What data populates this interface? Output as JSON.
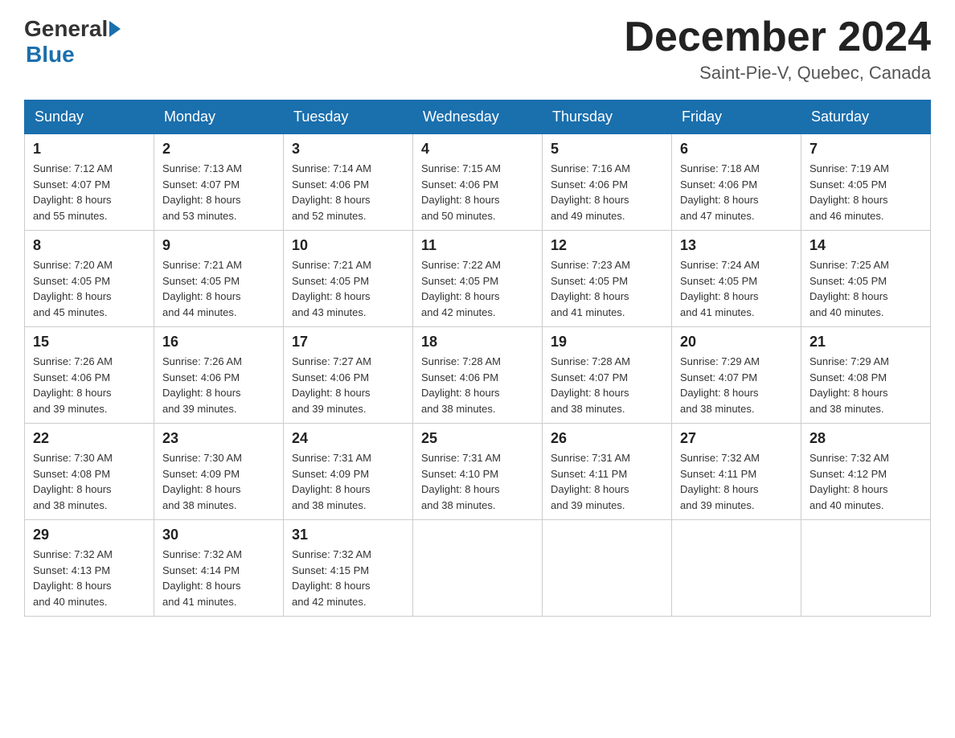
{
  "header": {
    "logo_general": "General",
    "logo_blue": "Blue",
    "title": "December 2024",
    "location": "Saint-Pie-V, Quebec, Canada"
  },
  "weekdays": [
    "Sunday",
    "Monday",
    "Tuesday",
    "Wednesday",
    "Thursday",
    "Friday",
    "Saturday"
  ],
  "weeks": [
    [
      {
        "day": "1",
        "sunrise": "7:12 AM",
        "sunset": "4:07 PM",
        "daylight": "8 hours and 55 minutes."
      },
      {
        "day": "2",
        "sunrise": "7:13 AM",
        "sunset": "4:07 PM",
        "daylight": "8 hours and 53 minutes."
      },
      {
        "day": "3",
        "sunrise": "7:14 AM",
        "sunset": "4:06 PM",
        "daylight": "8 hours and 52 minutes."
      },
      {
        "day": "4",
        "sunrise": "7:15 AM",
        "sunset": "4:06 PM",
        "daylight": "8 hours and 50 minutes."
      },
      {
        "day": "5",
        "sunrise": "7:16 AM",
        "sunset": "4:06 PM",
        "daylight": "8 hours and 49 minutes."
      },
      {
        "day": "6",
        "sunrise": "7:18 AM",
        "sunset": "4:06 PM",
        "daylight": "8 hours and 47 minutes."
      },
      {
        "day": "7",
        "sunrise": "7:19 AM",
        "sunset": "4:05 PM",
        "daylight": "8 hours and 46 minutes."
      }
    ],
    [
      {
        "day": "8",
        "sunrise": "7:20 AM",
        "sunset": "4:05 PM",
        "daylight": "8 hours and 45 minutes."
      },
      {
        "day": "9",
        "sunrise": "7:21 AM",
        "sunset": "4:05 PM",
        "daylight": "8 hours and 44 minutes."
      },
      {
        "day": "10",
        "sunrise": "7:21 AM",
        "sunset": "4:05 PM",
        "daylight": "8 hours and 43 minutes."
      },
      {
        "day": "11",
        "sunrise": "7:22 AM",
        "sunset": "4:05 PM",
        "daylight": "8 hours and 42 minutes."
      },
      {
        "day": "12",
        "sunrise": "7:23 AM",
        "sunset": "4:05 PM",
        "daylight": "8 hours and 41 minutes."
      },
      {
        "day": "13",
        "sunrise": "7:24 AM",
        "sunset": "4:05 PM",
        "daylight": "8 hours and 41 minutes."
      },
      {
        "day": "14",
        "sunrise": "7:25 AM",
        "sunset": "4:05 PM",
        "daylight": "8 hours and 40 minutes."
      }
    ],
    [
      {
        "day": "15",
        "sunrise": "7:26 AM",
        "sunset": "4:06 PM",
        "daylight": "8 hours and 39 minutes."
      },
      {
        "day": "16",
        "sunrise": "7:26 AM",
        "sunset": "4:06 PM",
        "daylight": "8 hours and 39 minutes."
      },
      {
        "day": "17",
        "sunrise": "7:27 AM",
        "sunset": "4:06 PM",
        "daylight": "8 hours and 39 minutes."
      },
      {
        "day": "18",
        "sunrise": "7:28 AM",
        "sunset": "4:06 PM",
        "daylight": "8 hours and 38 minutes."
      },
      {
        "day": "19",
        "sunrise": "7:28 AM",
        "sunset": "4:07 PM",
        "daylight": "8 hours and 38 minutes."
      },
      {
        "day": "20",
        "sunrise": "7:29 AM",
        "sunset": "4:07 PM",
        "daylight": "8 hours and 38 minutes."
      },
      {
        "day": "21",
        "sunrise": "7:29 AM",
        "sunset": "4:08 PM",
        "daylight": "8 hours and 38 minutes."
      }
    ],
    [
      {
        "day": "22",
        "sunrise": "7:30 AM",
        "sunset": "4:08 PM",
        "daylight": "8 hours and 38 minutes."
      },
      {
        "day": "23",
        "sunrise": "7:30 AM",
        "sunset": "4:09 PM",
        "daylight": "8 hours and 38 minutes."
      },
      {
        "day": "24",
        "sunrise": "7:31 AM",
        "sunset": "4:09 PM",
        "daylight": "8 hours and 38 minutes."
      },
      {
        "day": "25",
        "sunrise": "7:31 AM",
        "sunset": "4:10 PM",
        "daylight": "8 hours and 38 minutes."
      },
      {
        "day": "26",
        "sunrise": "7:31 AM",
        "sunset": "4:11 PM",
        "daylight": "8 hours and 39 minutes."
      },
      {
        "day": "27",
        "sunrise": "7:32 AM",
        "sunset": "4:11 PM",
        "daylight": "8 hours and 39 minutes."
      },
      {
        "day": "28",
        "sunrise": "7:32 AM",
        "sunset": "4:12 PM",
        "daylight": "8 hours and 40 minutes."
      }
    ],
    [
      {
        "day": "29",
        "sunrise": "7:32 AM",
        "sunset": "4:13 PM",
        "daylight": "8 hours and 40 minutes."
      },
      {
        "day": "30",
        "sunrise": "7:32 AM",
        "sunset": "4:14 PM",
        "daylight": "8 hours and 41 minutes."
      },
      {
        "day": "31",
        "sunrise": "7:32 AM",
        "sunset": "4:15 PM",
        "daylight": "8 hours and 42 minutes."
      },
      null,
      null,
      null,
      null
    ]
  ],
  "labels": {
    "sunrise": "Sunrise:",
    "sunset": "Sunset:",
    "daylight": "Daylight:"
  }
}
